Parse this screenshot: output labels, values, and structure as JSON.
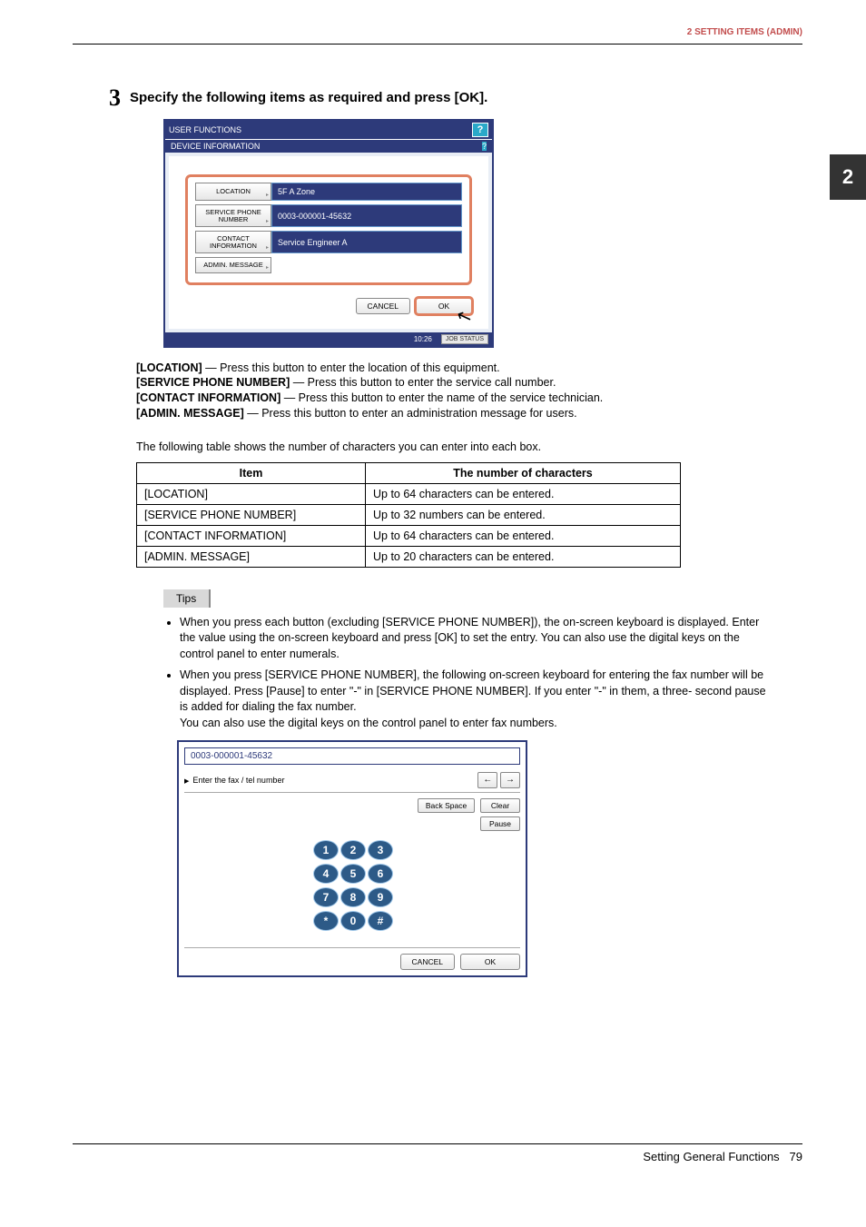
{
  "header": {
    "breadcrumb": "2 SETTING ITEMS (ADMIN)",
    "chapter": "2"
  },
  "step": {
    "num": "3",
    "title": "Specify the following items as required and press [OK]."
  },
  "shot1": {
    "titlebar": "USER FUNCTIONS",
    "subtitle": "DEVICE INFORMATION",
    "fields": [
      {
        "label": "LOCATION",
        "value": "5F A Zone"
      },
      {
        "label": "SERVICE PHONE NUMBER",
        "value": "0003-000001-45632"
      },
      {
        "label": "CONTACT INFORMATION",
        "value": "Service Engineer A"
      },
      {
        "label": "ADMIN. MESSAGE",
        "value": ""
      }
    ],
    "cancel": "CANCEL",
    "ok": "OK",
    "time": "10:26",
    "jobstatus": "JOB STATUS"
  },
  "explain": [
    {
      "key": "[LOCATION]",
      "text": " — Press this button to enter the location of this equipment."
    },
    {
      "key": "[SERVICE PHONE NUMBER]",
      "text": " — Press this button to enter the service call number."
    },
    {
      "key": "[CONTACT INFORMATION]",
      "text": " — Press this button to enter the name of the service technician."
    },
    {
      "key": "[ADMIN. MESSAGE]",
      "text": " — Press this button to enter an administration message for users."
    }
  ],
  "table_intro": "The following table shows the number of characters you can enter into each box.",
  "table": {
    "head": [
      "Item",
      "The number of characters"
    ],
    "rows": [
      [
        "[LOCATION]",
        "Up to 64 characters can be entered."
      ],
      [
        "[SERVICE PHONE NUMBER]",
        "Up to 32 numbers can be entered."
      ],
      [
        "[CONTACT INFORMATION]",
        "Up to 64 characters can be entered."
      ],
      [
        "[ADMIN. MESSAGE]",
        "Up to 20 characters can be entered."
      ]
    ]
  },
  "tips_label": "Tips",
  "tips": [
    "When you press each button (excluding [SERVICE PHONE NUMBER]), the on-screen keyboard is displayed. Enter the value using the on-screen keyboard and press [OK] to set the entry. You can also use the digital keys on the control panel to enter numerals.",
    "When you press [SERVICE PHONE NUMBER], the following on-screen keyboard for entering the fax number will be displayed. Press [Pause] to enter \"-\" in [SERVICE PHONE NUMBER]. If you enter \"-\" in them, a three- second pause is added for dialing the fax number.\nYou can also use the digital keys on the control panel to enter fax numbers."
  ],
  "shot2": {
    "input_value": "0003-000001-45632",
    "hint": "Enter the fax / tel number",
    "backspace": "Back Space",
    "clear": "Clear",
    "pause": "Pause",
    "keys": [
      "1",
      "2",
      "3",
      "4",
      "5",
      "6",
      "7",
      "8",
      "9",
      "*",
      "0",
      "#"
    ],
    "cancel": "CANCEL",
    "ok": "OK"
  },
  "footer": {
    "section": "Setting General Functions",
    "page": "79"
  }
}
